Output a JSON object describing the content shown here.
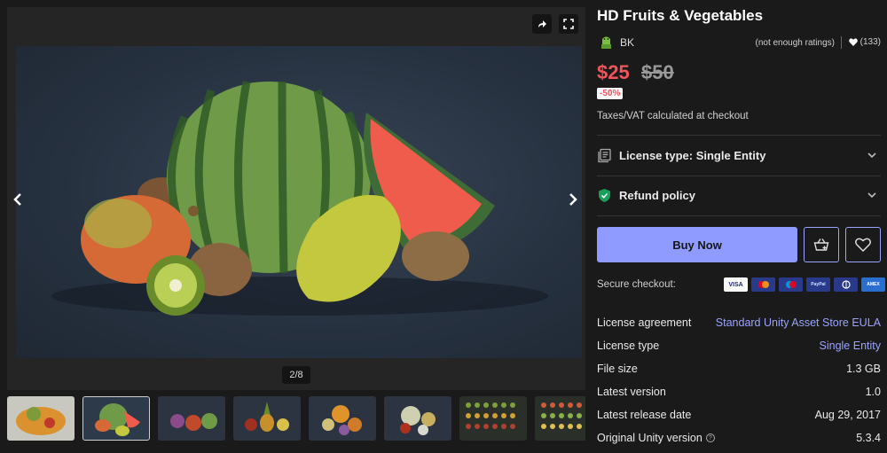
{
  "gallery": {
    "counter": "2/8",
    "thumbnail_count": 8
  },
  "product": {
    "title": "HD Fruits & Vegetables",
    "publisher": "BK",
    "ratings_text": "(not enough ratings)",
    "favorites": "(133)",
    "price": "$25",
    "original_price": "$50",
    "discount": "-50%",
    "tax_note": "Taxes/VAT calculated at checkout"
  },
  "accordions": {
    "license": "License type: Single Entity",
    "refund": "Refund policy"
  },
  "actions": {
    "buy_label": "Buy Now"
  },
  "checkout": {
    "label": "Secure checkout:",
    "cards": [
      "VISA",
      "",
      "",
      "PayPal",
      "",
      "AMEX"
    ]
  },
  "specs": [
    {
      "key": "License agreement",
      "value": "Standard Unity Asset Store EULA"
    },
    {
      "key": "License type",
      "value": "Single Entity"
    },
    {
      "key": "File size",
      "value": "1.3 GB"
    },
    {
      "key": "Latest version",
      "value": "1.0"
    },
    {
      "key": "Latest release date",
      "value": "Aug 29, 2017"
    },
    {
      "key": "Original Unity version",
      "value": "5.3.4"
    }
  ],
  "colors": {
    "background": "#1a1a1a",
    "accent": "#8f9bff",
    "sale_red": "#f2545b",
    "link": "#9aa4ff"
  }
}
